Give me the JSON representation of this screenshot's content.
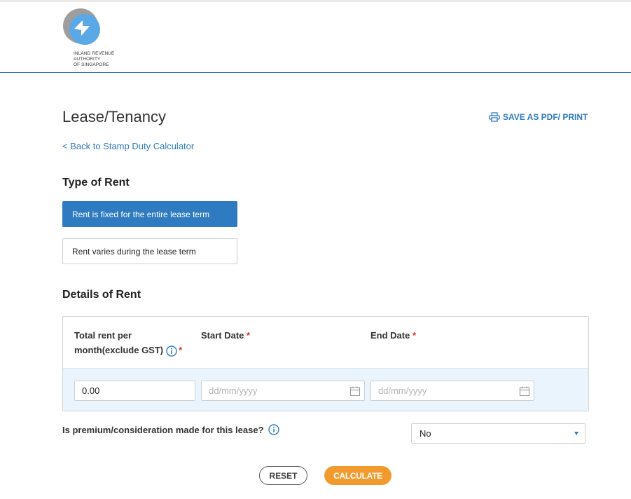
{
  "brand": {
    "logo_text": "INLAND REVENUE\nAUTHORITY\nOF SINGAPORE"
  },
  "page": {
    "title": "Lease/Tenancy",
    "save_pdf_label": "SAVE AS PDF/ PRINT",
    "back_link": "< Back to Stamp Duty Calculator"
  },
  "type_of_rent": {
    "heading": "Type of Rent",
    "options": [
      {
        "label": "Rent is fixed for the entire lease term",
        "selected": true
      },
      {
        "label": "Rent varies during the lease term",
        "selected": false
      }
    ]
  },
  "details_of_rent": {
    "heading": "Details of Rent",
    "columns": {
      "total_rent_line1": "Total rent per",
      "total_rent_line2": "month(exclude GST)",
      "start_date": "Start Date",
      "end_date": "End Date",
      "required_marker": "*"
    },
    "fields": {
      "total_rent_value": "0.00",
      "start_date_placeholder": "dd/mm/yyyy",
      "end_date_placeholder": "dd/mm/yyyy"
    }
  },
  "premium": {
    "question": "Is premium/consideration made for this lease?",
    "selected": "No"
  },
  "actions": {
    "reset_label": "RESET",
    "calculate_label": "CALCULATE"
  },
  "colors": {
    "accent_blue": "#2f7bc1",
    "calculate_orange": "#f29a2e",
    "required_red": "#d9312b"
  }
}
